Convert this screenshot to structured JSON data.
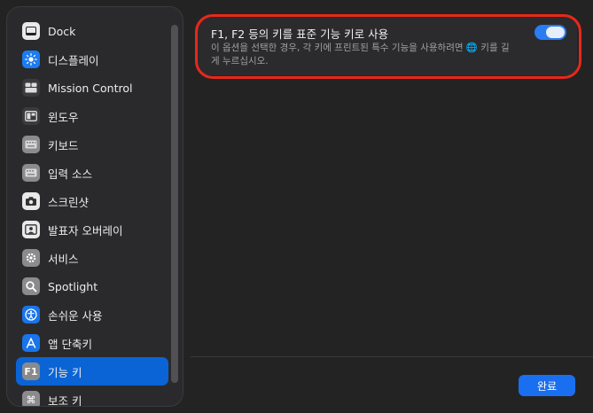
{
  "sidebar": {
    "items": [
      {
        "label": "Dock",
        "icon": "dock-icon"
      },
      {
        "label": "디스플레이",
        "icon": "display-brightness-icon"
      },
      {
        "label": "Mission Control",
        "icon": "mission-control-icon"
      },
      {
        "label": "윈도우",
        "icon": "window-icon"
      },
      {
        "label": "키보드",
        "icon": "keyboard-icon"
      },
      {
        "label": "입력 소스",
        "icon": "input-source-icon"
      },
      {
        "label": "스크린샷",
        "icon": "screenshot-camera-icon"
      },
      {
        "label": "발표자 오버레이",
        "icon": "presenter-overlay-icon"
      },
      {
        "label": "서비스",
        "icon": "services-gear-icon"
      },
      {
        "label": "Spotlight",
        "icon": "spotlight-search-icon"
      },
      {
        "label": "손쉬운 사용",
        "icon": "accessibility-icon"
      },
      {
        "label": "앱 단축키",
        "icon": "app-shortcuts-icon"
      },
      {
        "label": "기능 키",
        "icon": "function-keys-icon",
        "selected": true,
        "icon_text": "F1"
      },
      {
        "label": "보조 키",
        "icon": "modifier-keys-icon",
        "icon_text": "⌘"
      }
    ]
  },
  "setting": {
    "title": "F1, F2 등의 키를 표준 기능 키로 사용",
    "description": "이 옵션을 선택한 경우, 각 키에 프린트된 특수 기능을 사용하려면 🌐 키를 길게 누르십시오.",
    "toggle_on": true
  },
  "footer": {
    "done_label": "완료"
  },
  "colors": {
    "accent": "#1a6ff0",
    "highlight_ring": "#e8281a"
  }
}
